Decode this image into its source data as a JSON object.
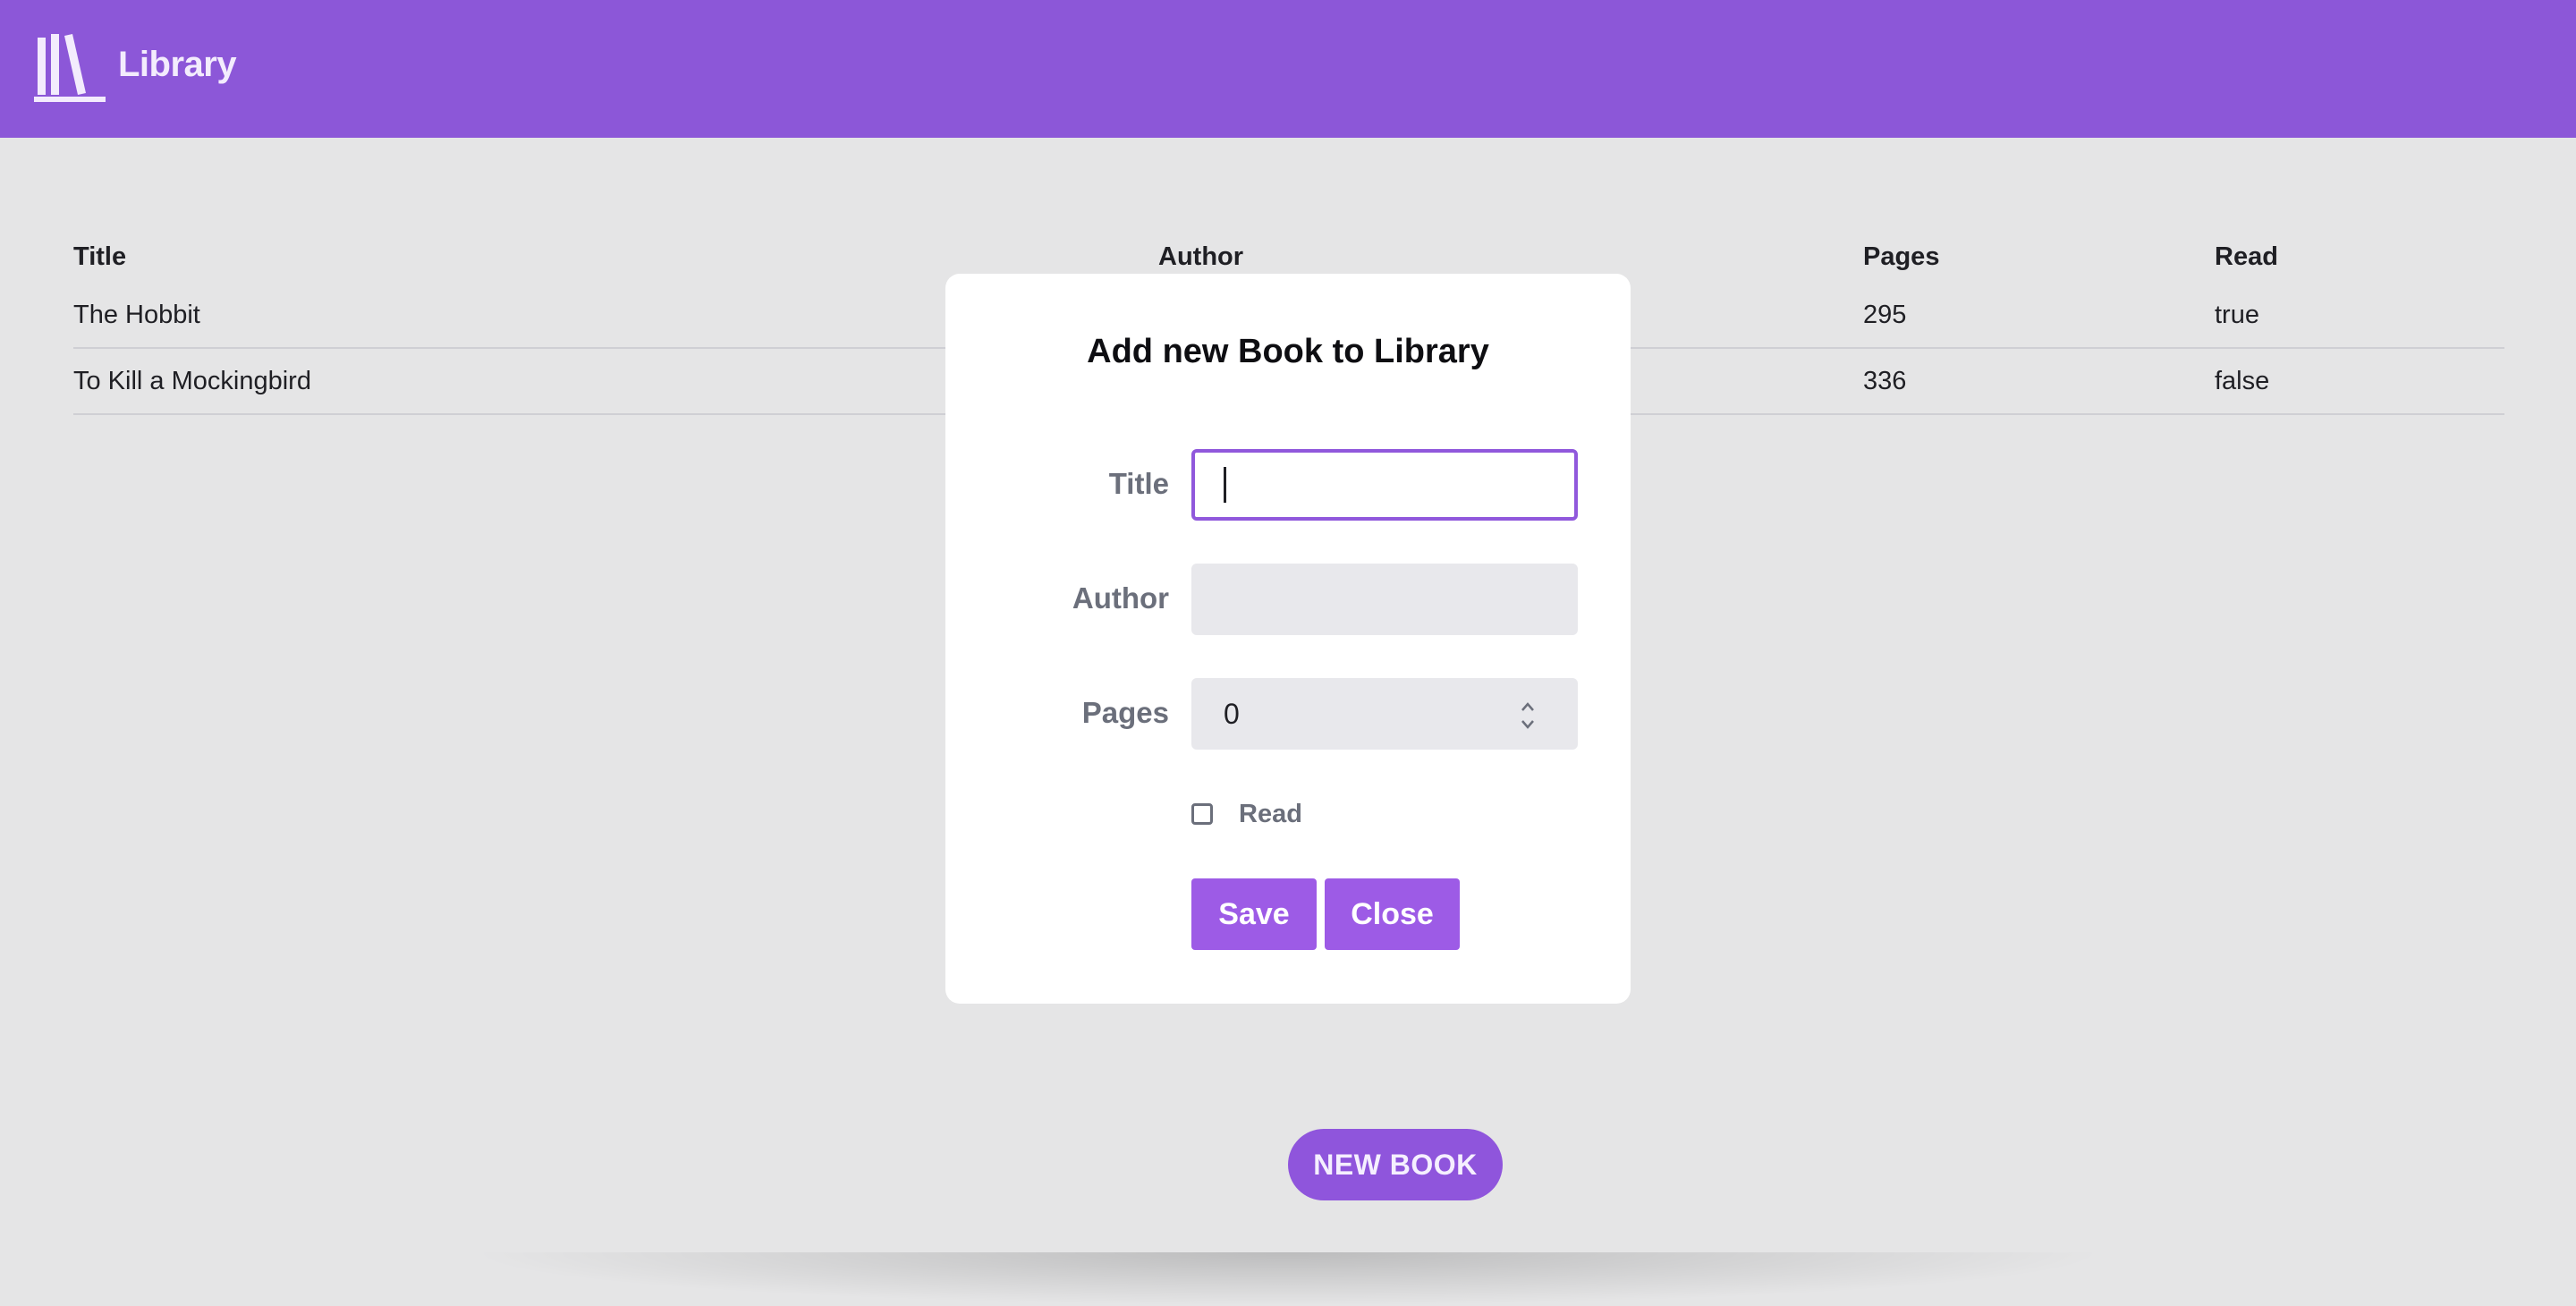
{
  "header": {
    "app_title": "Library",
    "logo_icon": "bookshelf-icon",
    "bg_color": "#8c57d8"
  },
  "table": {
    "columns": [
      "Title",
      "Author",
      "Pages",
      "Read"
    ],
    "rows": [
      {
        "title": "The Hobbit",
        "author": "",
        "pages": "295",
        "read": "true"
      },
      {
        "title": "To Kill a Mockingbird",
        "author": "",
        "pages": "336",
        "read": "false"
      }
    ]
  },
  "modal": {
    "title": "Add new Book to Library",
    "fields": {
      "title_label": "Title",
      "title_value": "",
      "author_label": "Author",
      "author_value": "",
      "pages_label": "Pages",
      "pages_value": "0",
      "read_label": "Read",
      "read_checked": false
    },
    "buttons": {
      "save": "Save",
      "close": "Close"
    }
  },
  "new_book_button": "NEW BOOK",
  "accent_color": "#9058dc"
}
